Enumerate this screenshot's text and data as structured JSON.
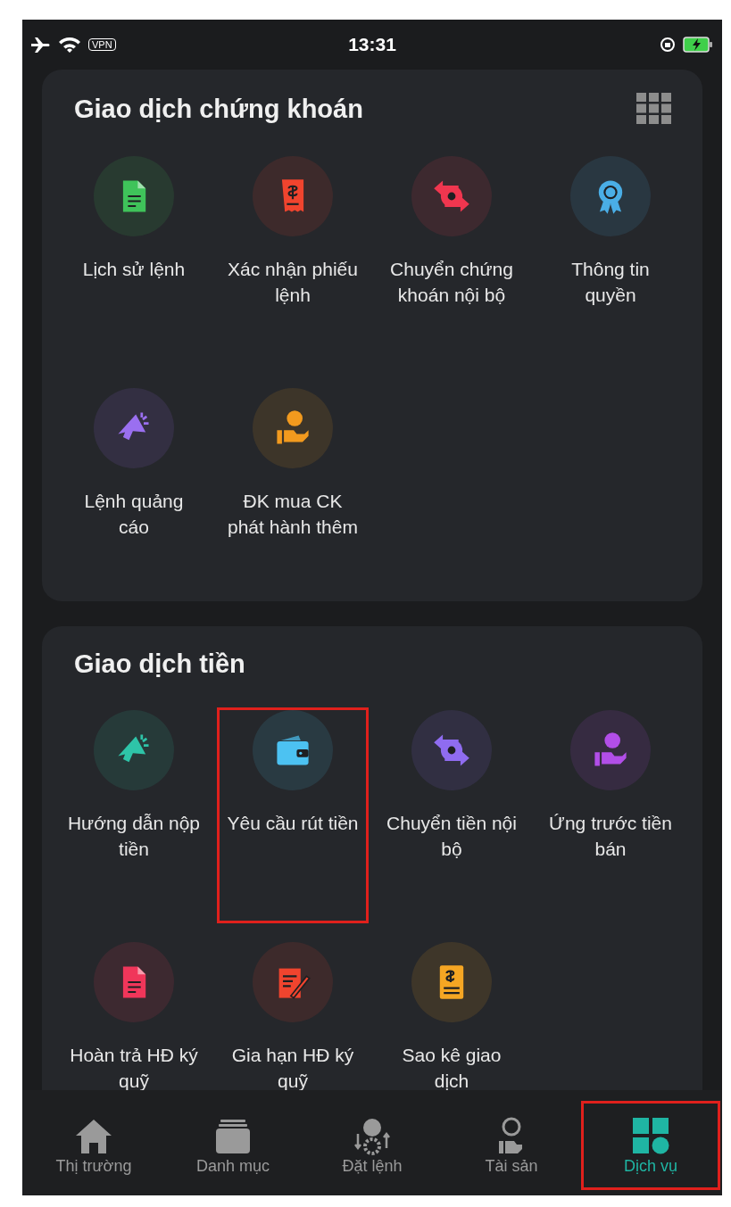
{
  "status_bar": {
    "vpn": "VPN",
    "time": "13:31"
  },
  "sections": [
    {
      "title": "Giao dịch chứng khoán",
      "items": [
        {
          "label": "Lịch sử lệnh",
          "kind": "document",
          "color": "#3fc35a",
          "highlighted": false
        },
        {
          "label": "Xác nhận phiếu lệnh",
          "kind": "receipt",
          "color": "#f0442e",
          "highlighted": false
        },
        {
          "label": "Chuyển chứng khoán nội bộ",
          "kind": "transfer",
          "color": "#f0364f",
          "highlighted": false
        },
        {
          "label": "Thông tin quyền",
          "kind": "award",
          "color": "#4aaee6",
          "highlighted": false
        },
        {
          "label": "Lệnh quảng cáo",
          "kind": "megaphone",
          "color": "#9a6ff0",
          "highlighted": false
        },
        {
          "label": "ĐK mua CK phát hành thêm",
          "kind": "coin-hand",
          "color": "#f29a1e",
          "highlighted": false
        }
      ]
    },
    {
      "title": "Giao dịch tiền",
      "items": [
        {
          "label": "Hướng dẫn nộp tiền",
          "kind": "megaphone",
          "color": "#2ec4a8",
          "highlighted": false
        },
        {
          "label": "Yêu cầu rút tiền",
          "kind": "wallet",
          "color": "#4cc2f2",
          "highlighted": true
        },
        {
          "label": "Chuyển tiền nội bộ",
          "kind": "transfer",
          "color": "#8f6cf0",
          "highlighted": false
        },
        {
          "label": "Ứng trước tiền bán",
          "kind": "coin-hand",
          "color": "#b24ee8",
          "highlighted": false
        },
        {
          "label": "Hoàn trả HĐ ký quỹ",
          "kind": "document",
          "color": "#f0365a",
          "highlighted": false
        },
        {
          "label": "Gia hạn HĐ ký quỹ",
          "kind": "signature",
          "color": "#f0442e",
          "highlighted": false
        },
        {
          "label": "Sao kê giao dịch",
          "kind": "statement",
          "color": "#f5a623",
          "highlighted": false
        }
      ]
    }
  ],
  "tab_bar": [
    {
      "label": "Thị trường",
      "kind": "home",
      "selected": false,
      "highlighted": false
    },
    {
      "label": "Danh mục",
      "kind": "folder",
      "selected": false,
      "highlighted": false
    },
    {
      "label": "Đặt lệnh",
      "kind": "order",
      "selected": false,
      "highlighted": false
    },
    {
      "label": "Tài sản",
      "kind": "asset",
      "selected": false,
      "highlighted": false
    },
    {
      "label": "Dịch vụ",
      "kind": "services",
      "selected": true,
      "highlighted": true
    }
  ]
}
